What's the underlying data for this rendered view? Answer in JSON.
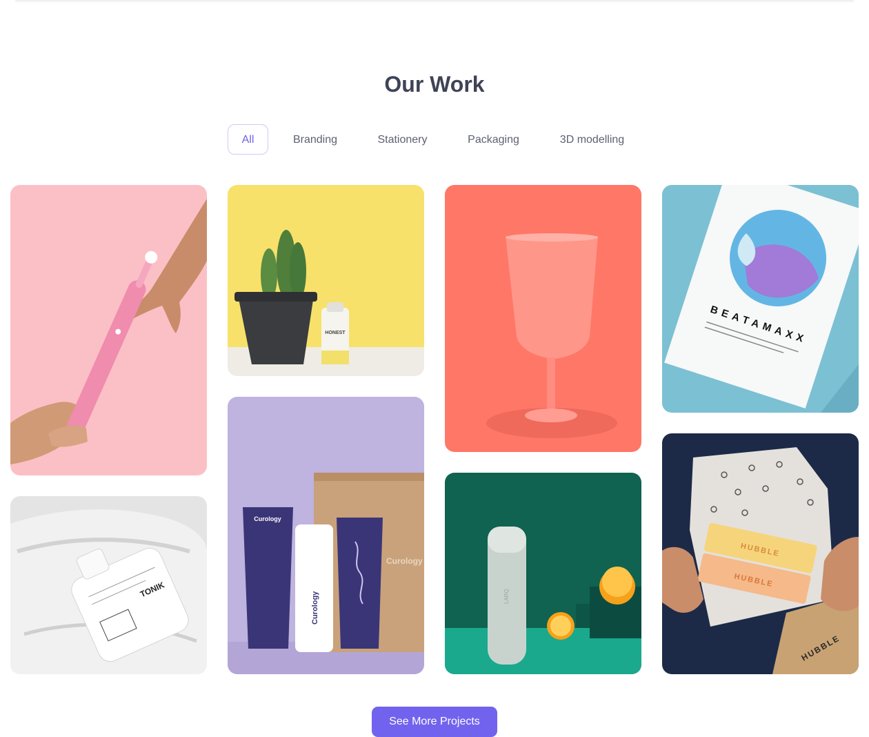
{
  "section": {
    "title": "Our Work"
  },
  "filters": [
    {
      "label": "All",
      "active": true
    },
    {
      "label": "Branding",
      "active": false
    },
    {
      "label": "Stationery",
      "active": false
    },
    {
      "label": "Packaging",
      "active": false
    },
    {
      "label": "3D modelling",
      "active": false
    }
  ],
  "projects": {
    "toothbrush": {
      "image": "pink-toothbrush-photo",
      "background": "#fbc0c5"
    },
    "cactus": {
      "image": "cactus-honest-photo",
      "background": "#f7e16a",
      "brand": "HONEST"
    },
    "goblet": {
      "image": "coral-goblet-photo",
      "background": "#ff7767"
    },
    "poster": {
      "image": "beatamaxx-poster-photo",
      "background": "#7cc0d4",
      "brand": "BEATAMAXX"
    },
    "tonik": {
      "image": "tonik-bottle-photo",
      "background": "#e8e8e8",
      "brand": "TONIK"
    },
    "curology": {
      "image": "curology-tubes-photo",
      "background": "#bfb3df",
      "brand": "Curology"
    },
    "bottle": {
      "image": "larq-bottle-photo",
      "background": "#0f6350",
      "brand": "LARQ"
    },
    "hubble": {
      "image": "hubble-box-photo",
      "background": "#1c2a48",
      "brand": "HUBBLE"
    }
  },
  "cta": {
    "label": "See More Projects"
  },
  "colors": {
    "accent": "#7263ee",
    "title": "#3f4357",
    "filter_text": "#5c5f73"
  }
}
